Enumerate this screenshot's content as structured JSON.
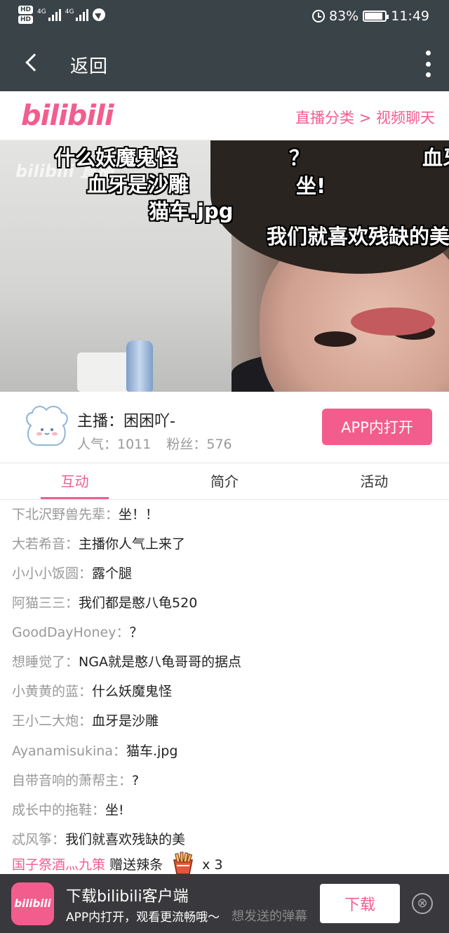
{
  "status_bar": {
    "hd1": "HD",
    "hd2": "HD",
    "net1": "4G",
    "net2": "4G",
    "battery": "83%",
    "time": "11:49"
  },
  "app_bar": {
    "back_label": "返回"
  },
  "header": {
    "logo": "bilibili",
    "breadcrumb": "直播分类 > 视频聊天"
  },
  "video": {
    "watermark": "bilibili 直播",
    "danmaku": [
      {
        "text": "什么妖魔鬼怪"
      },
      {
        "text": "血牙是沙雕"
      },
      {
        "text": "猫车.jpg"
      },
      {
        "text": "？"
      },
      {
        "text": "坐!"
      },
      {
        "text": "我们就喜欢残缺的美"
      },
      {
        "text": "血牙"
      }
    ]
  },
  "streamer": {
    "name": "主播：困困吖-",
    "popularity": "人气：1011",
    "fans": "粉丝：576",
    "open_app": "APP内打开"
  },
  "tabs": [
    {
      "label": "互动",
      "active": true
    },
    {
      "label": "简介",
      "active": false
    },
    {
      "label": "活动",
      "active": false
    }
  ],
  "chat": [
    {
      "user": "下北沢野兽先辈：",
      "msg": "坐！！"
    },
    {
      "user": "大若希音：",
      "msg": "主播你人气上来了"
    },
    {
      "user": "小小小饭圆：",
      "msg": "露个腿"
    },
    {
      "user": "阿猫三三：",
      "msg": "我们都是憨八龟520"
    },
    {
      "user": "GoodDayHoney：",
      "msg": "？"
    },
    {
      "user": "想睡觉了：",
      "msg": "NGA就是憨八龟哥哥的据点"
    },
    {
      "user": "小黄黄的蓝：",
      "msg": "什么妖魔鬼怪"
    },
    {
      "user": "王小二大炮：",
      "msg": "血牙是沙雕"
    },
    {
      "user": "Ayanamisukina：",
      "msg": "猫车.jpg"
    },
    {
      "user": "自带音响的萧帮主：",
      "msg": "?"
    },
    {
      "user": "成长中的拖鞋：",
      "msg": "坐!"
    },
    {
      "user": "忒风筝：",
      "msg": "我们就喜欢残缺的美"
    }
  ],
  "gift": {
    "user": "国子祭酒灬九策",
    "action": "赠送辣条",
    "count": "x 3"
  },
  "download_bar": {
    "logo": "bilibili",
    "title": "下载bilibili客户端",
    "subtitle": "APP内打开，观看更流畅哦～",
    "input_placeholder": "想发送的弹幕",
    "button": "下载",
    "close": "⊗"
  },
  "colors": {
    "accent": "#f25d8e",
    "app_bar": "#3a4347"
  }
}
